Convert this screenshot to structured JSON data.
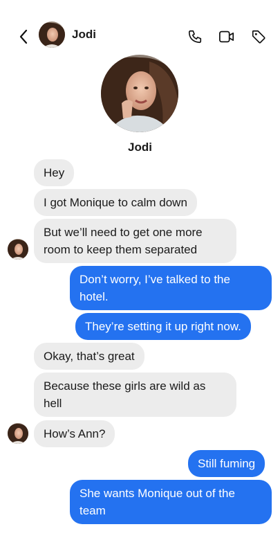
{
  "header": {
    "back_icon": "chevron-left-icon",
    "contact_name": "Jodi",
    "actions": [
      "phone-icon",
      "video-camera-icon",
      "tag-icon"
    ]
  },
  "profile": {
    "name": "Jodi"
  },
  "colors": {
    "incoming_bg": "#ececec",
    "outgoing_bg": "#2472f0",
    "outgoing_text": "#ffffff"
  },
  "messages": [
    {
      "direction": "in",
      "text": "Hey"
    },
    {
      "direction": "in",
      "text": "I got Monique to calm down"
    },
    {
      "direction": "in",
      "text": "But we’ll need to get one more room to keep them separated"
    },
    {
      "direction": "out",
      "text": "Don’t worry, I’ve talked to the hotel."
    },
    {
      "direction": "out",
      "text": "They’re setting it up right now."
    },
    {
      "direction": "in",
      "text": "Okay, that’s great"
    },
    {
      "direction": "in",
      "text": "Because these girls are wild as hell"
    },
    {
      "direction": "in",
      "text": "How’s Ann?"
    },
    {
      "direction": "out",
      "text": "Still fuming"
    },
    {
      "direction": "out",
      "text": "She wants Monique out of the team"
    }
  ]
}
